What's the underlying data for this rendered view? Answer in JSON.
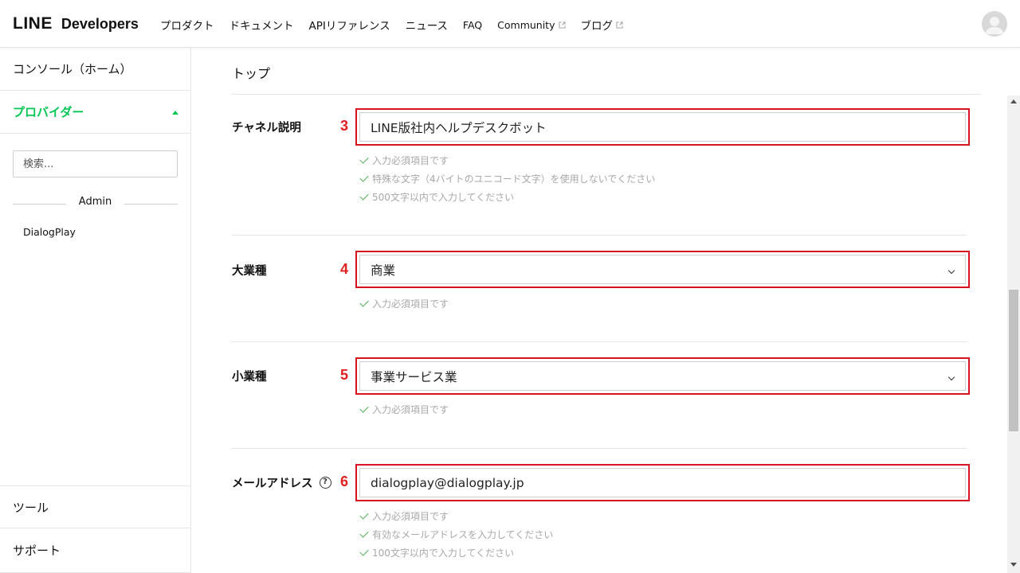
{
  "header": {
    "logo_line": "LINE",
    "logo_developers": "Developers",
    "nav": [
      {
        "label": "プロダクト",
        "external": false
      },
      {
        "label": "ドキュメント",
        "external": false
      },
      {
        "label": "APIリファレンス",
        "external": false
      },
      {
        "label": "ニュース",
        "external": false
      },
      {
        "label": "FAQ",
        "external": false
      },
      {
        "label": "Community",
        "external": true
      },
      {
        "label": "ブログ",
        "external": true
      }
    ]
  },
  "sidebar": {
    "home": "コンソール（ホーム）",
    "provider": "プロバイダー",
    "search_placeholder": "検索...",
    "divider_label": "Admin",
    "account": "DialogPlay",
    "tool": "ツール",
    "support": "サポート"
  },
  "main": {
    "page_title": "トップ",
    "fields": [
      {
        "label": "チャネル説明",
        "number": "3",
        "value": "LINE版社内ヘルプデスクボット",
        "type": "text",
        "hints": [
          "入力必須項目です",
          "特殊な文字（4バイトのユニコード文字）を使用しないでください",
          "500文字以内で入力してください"
        ]
      },
      {
        "label": "大業種",
        "number": "4",
        "value": "商業",
        "type": "select",
        "hints": [
          "入力必須項目です"
        ]
      },
      {
        "label": "小業種",
        "number": "5",
        "value": "事業サービス業",
        "type": "select",
        "hints": [
          "入力必須項目です"
        ]
      },
      {
        "label": "メールアドレス",
        "number": "6",
        "value": "dialogplay@dialogplay.jp",
        "type": "text",
        "hints": [
          "入力必須項目です",
          "有効なメールアドレスを入力してください",
          "100文字以内で入力してください"
        ]
      }
    ]
  },
  "colors": {
    "brand_green": "#06c755",
    "highlight_red": "#d7141f",
    "check_green": "#4caf50"
  },
  "icons": {
    "external": "external-link-icon",
    "help": "help-circle-icon",
    "check": "check-icon",
    "caret": "chevron-down-icon"
  }
}
